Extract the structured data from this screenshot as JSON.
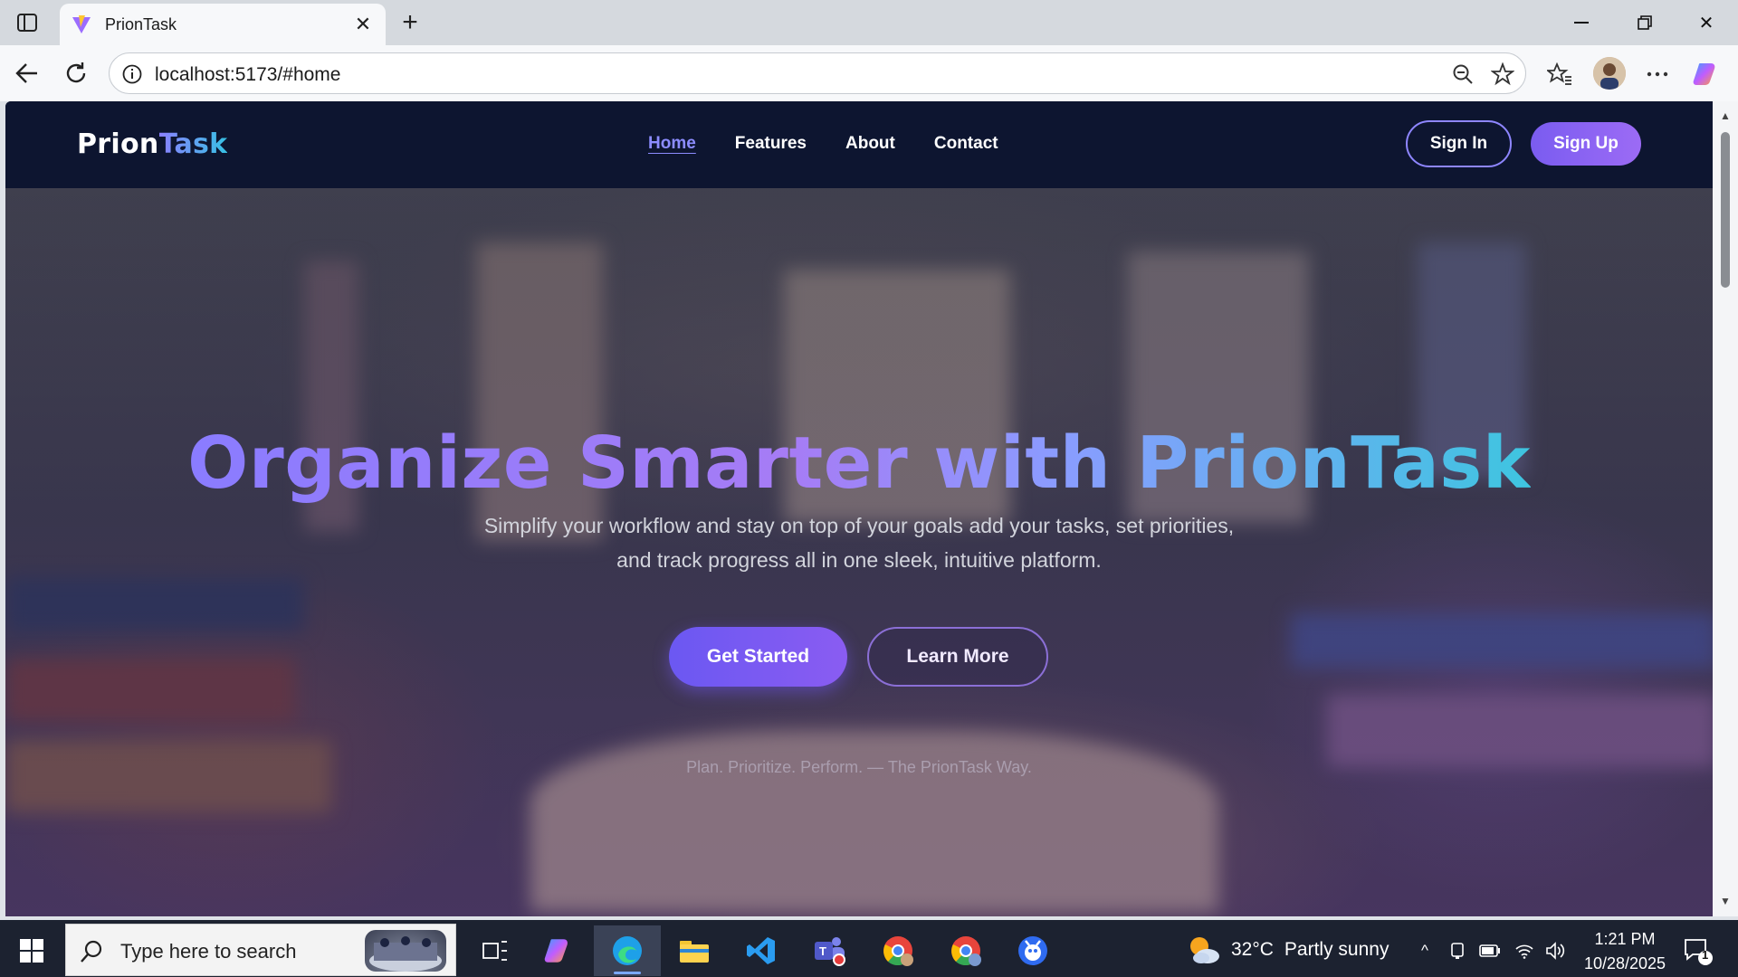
{
  "browser": {
    "tab_title": "PrionTask",
    "url": "localhost:5173/#home"
  },
  "site": {
    "logo_part1": "Prion",
    "logo_part2": "Task",
    "nav": [
      "Home",
      "Features",
      "About",
      "Contact"
    ],
    "active_nav": "Home",
    "signin_label": "Sign In",
    "signup_label": "Sign Up"
  },
  "hero": {
    "title": "Organize Smarter with PrionTask",
    "subtitle_line1": "Simplify your workflow and stay on top of your goals add your tasks, set priorities,",
    "subtitle_line2": "and track progress all in one sleek, intuitive platform.",
    "primary_cta": "Get Started",
    "secondary_cta": "Learn More",
    "tagline": "Plan. Prioritize. Perform. — The PrionTask Way."
  },
  "taskbar": {
    "search_placeholder": "Type here to search",
    "weather_temp": "32°C",
    "weather_desc": "Partly sunny",
    "time": "1:21 PM",
    "date": "10/28/2025",
    "notification_count": "1"
  },
  "colors": {
    "header_bg": "#0d1530",
    "accent_purple": "#7a5cf0",
    "accent_cyan": "#37c1e4",
    "nav_active": "#8c8cff"
  }
}
